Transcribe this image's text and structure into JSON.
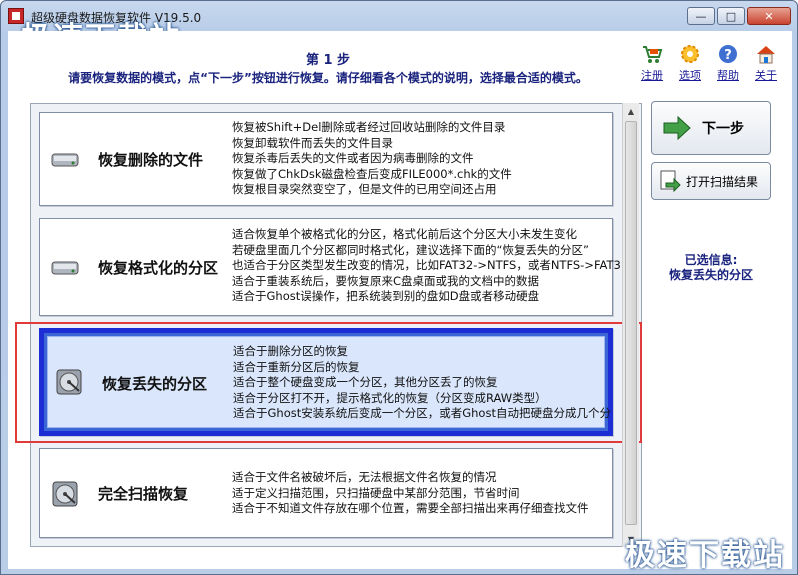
{
  "window": {
    "title": "超级硬盘数据恢复软件 V19.5.0",
    "minimize": "—",
    "maximize": "□",
    "close": "✕"
  },
  "watermark": "极速下载站",
  "header": {
    "step_title": "第 1 步",
    "step_desc": "请要恢复数据的模式，点“下一步”按钮进行恢复。请仔细看各个模式的说明，选择最合适的模式。"
  },
  "toolbar": [
    {
      "label": "注册",
      "icon": "cart-icon"
    },
    {
      "label": "选项",
      "icon": "gear-icon"
    },
    {
      "label": "帮助",
      "icon": "help-icon"
    },
    {
      "label": "关于",
      "icon": "home-icon"
    }
  ],
  "modes": [
    {
      "name": "恢复删除的文件",
      "selected": false,
      "lines": [
        "恢复被Shift+Del删除或者经过回收站删除的文件目录",
        "恢复卸载软件而丢失的文件目录",
        "恢复杀毒后丢失的文件或者因为病毒删除的文件",
        "恢复做了ChkDsk磁盘检查后变成FILE000*.chk的文件",
        "恢复根目录突然变空了，但是文件的已用空间还占用"
      ]
    },
    {
      "name": "恢复格式化的分区",
      "selected": false,
      "lines": [
        "适合恢复单个被格式化的分区，格式化前后这个分区大小未发生变化",
        "若硬盘里面几个分区都同时格式化，建议选择下面的“恢复丢失的分区”",
        "也适合于分区类型发生改变的情况，比如FAT32->NTFS，或者NTFS->FAT3",
        "适合于重装系统后，要恢复原来C盘桌面或我的文档中的数据",
        "适合于Ghost误操作，把系统装到别的盘如D盘或者移动硬盘"
      ]
    },
    {
      "name": "恢复丢失的分区",
      "selected": true,
      "lines": [
        "适合于删除分区的恢复",
        "适合于重新分区后的恢复",
        "适合于整个硬盘变成一个分区，其他分区丢了的恢复",
        "适合于分区打不开，提示格式化的恢复（分区变成RAW类型）",
        "适合于Ghost安装系统后变成一个分区，或者Ghost自动把硬盘分成几个分"
      ]
    },
    {
      "name": "完全扫描恢复",
      "selected": false,
      "lines": [
        "适合于文件名被破坏后，无法根据文件名恢复的情况",
        "适于定义扫描范围，只扫描硬盘中某部分范围，节省时间",
        "适合于不知道文件存放在哪个位置，需要全部扫描出来再仔细查找文件"
      ]
    }
  ],
  "buttons": {
    "next": "下一步",
    "open_scan": "打开扫描结果"
  },
  "selection_info": {
    "label": "已选信息:",
    "value": "恢复丢失的分区"
  },
  "colors": {
    "selected_border": "#1c2dd6",
    "highlight_outline": "#e03a3a",
    "heading_text": "#1a237e"
  }
}
